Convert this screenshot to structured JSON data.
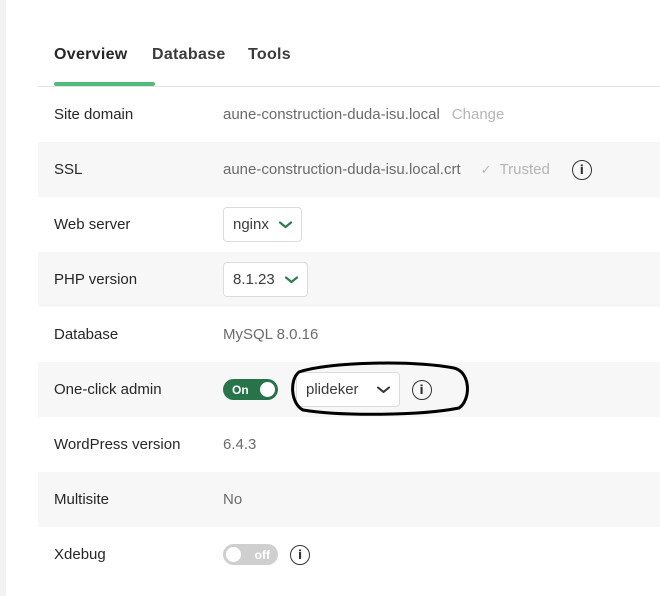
{
  "tabs": [
    {
      "label": "Overview",
      "active": true
    },
    {
      "label": "Database",
      "active": false
    },
    {
      "label": "Tools",
      "active": false
    }
  ],
  "rows": {
    "site_domain": {
      "label": "Site domain",
      "value": "aune-construction-duda-isu.local",
      "action": "Change"
    },
    "ssl": {
      "label": "SSL",
      "value": "aune-construction-duda-isu.local.crt",
      "status": "Trusted",
      "info_icon": "info-icon"
    },
    "web_server": {
      "label": "Web server",
      "selected": "nginx"
    },
    "php_version": {
      "label": "PHP version",
      "selected": "8.1.23"
    },
    "database": {
      "label": "Database",
      "value": "MySQL 8.0.16"
    },
    "one_click_admin": {
      "label": "One-click admin",
      "toggle_label": "On",
      "toggle_state": true,
      "selected_user": "plideker"
    },
    "wordpress_version": {
      "label": "WordPress version",
      "value": "6.4.3"
    },
    "multisite": {
      "label": "Multisite",
      "value": "No"
    },
    "xdebug": {
      "label": "Xdebug",
      "toggle_label": "off",
      "toggle_state": false
    }
  },
  "colors": {
    "accent": "#51bb7b",
    "toggle_on": "#27744a",
    "toggle_off": "#cfcfcf",
    "select_chevron": "#2e7d4f"
  }
}
